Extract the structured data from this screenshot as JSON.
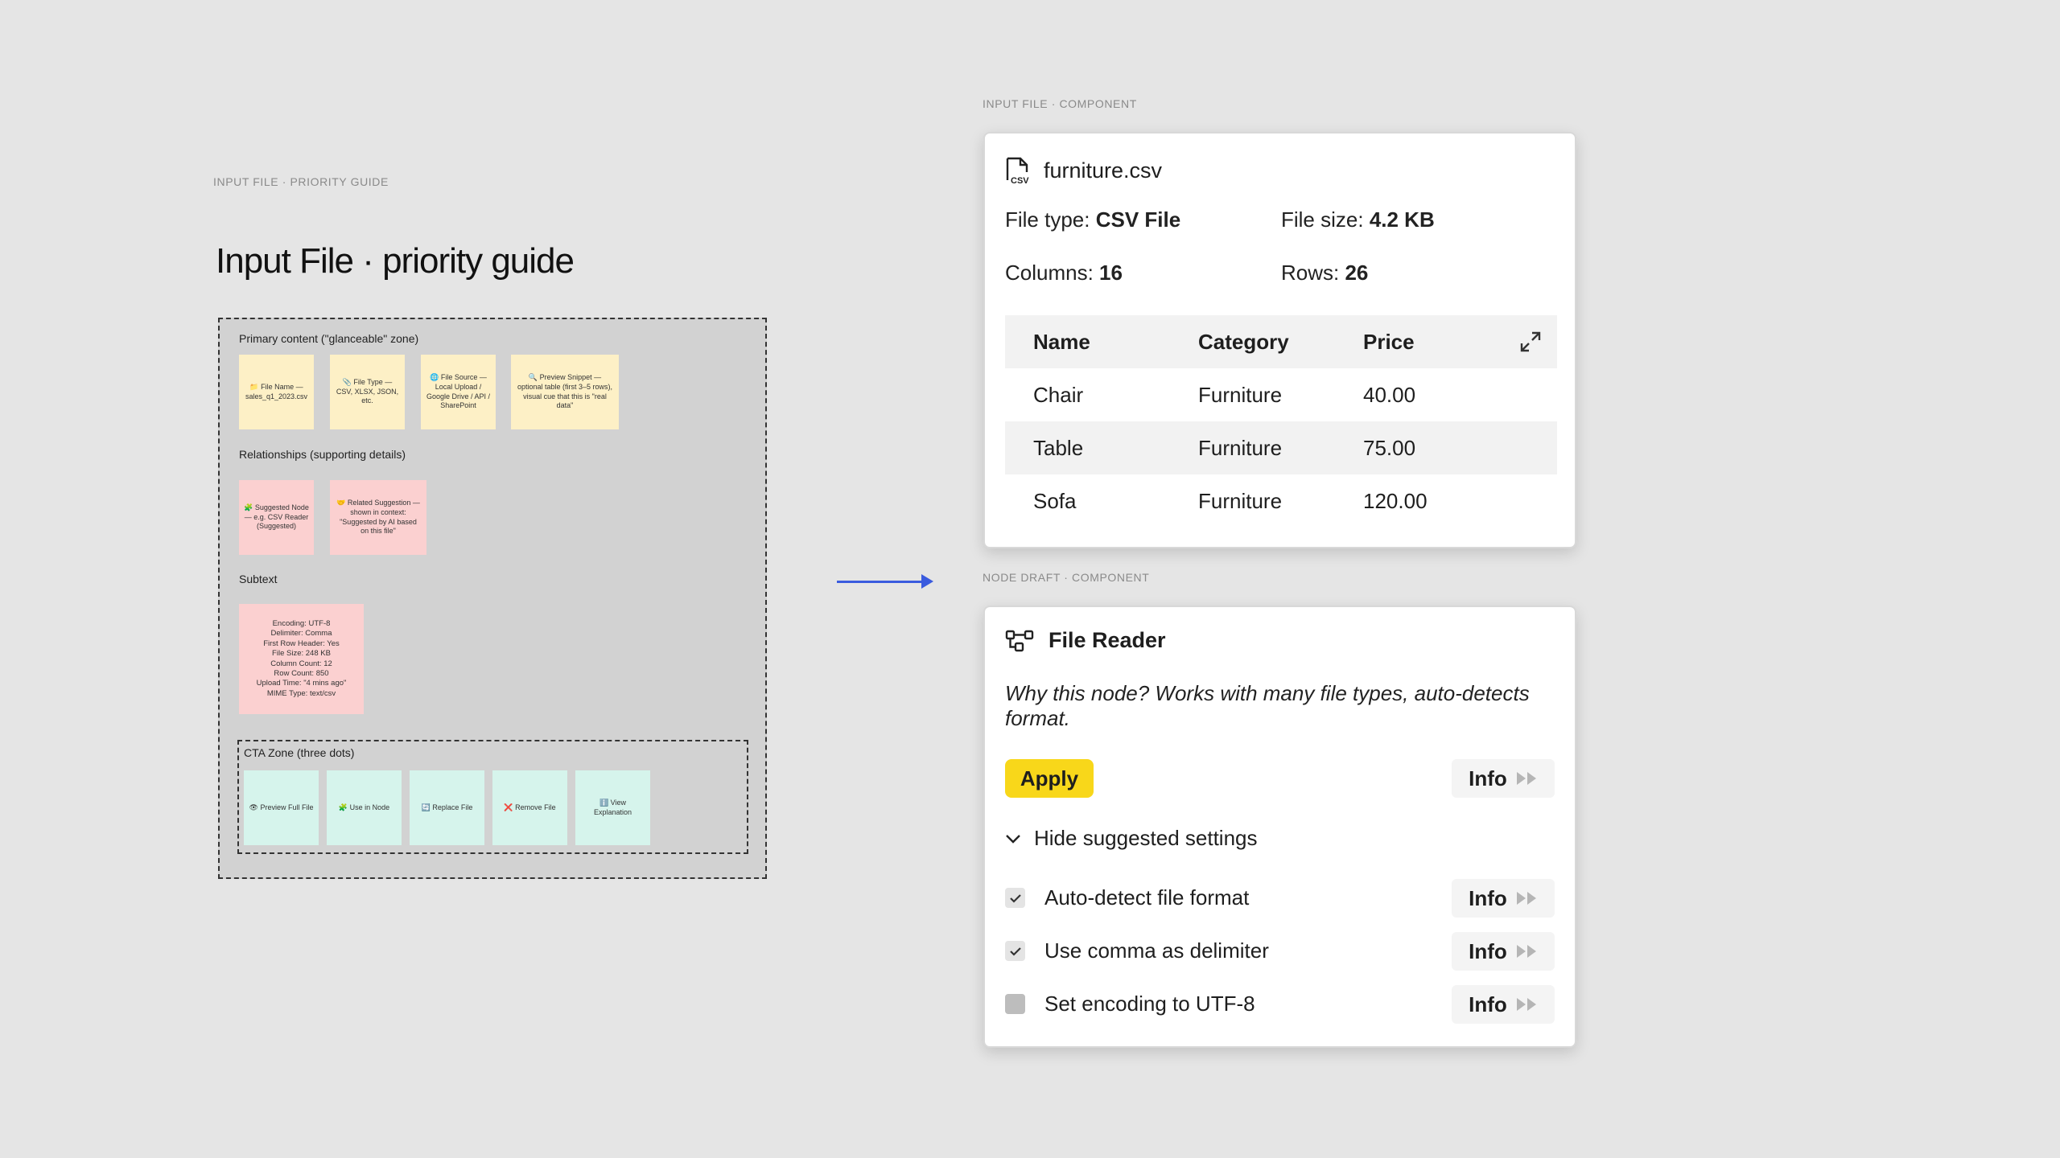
{
  "guide": {
    "frame_label": "INPUT FILE · PRIORITY GUIDE",
    "title": "Input File · priority guide",
    "primary_label": "Primary content (\"glanceable\" zone)",
    "primary_notes": [
      "📁 File Name — sales_q1_2023.csv",
      "📎 File Type — CSV, XLSX, JSON, etc.",
      "🌐 File Source — Local Upload / Google Drive / API / SharePoint",
      "🔍 Preview Snippet — optional table (first 3–5 rows), visual cue that this is \"real data\""
    ],
    "relationships_label": "Relationships (supporting details)",
    "relationship_notes": [
      "🧩 Suggested Node — e.g. CSV Reader (Suggested)",
      "🤝 Related Suggestion — shown in context: \"Suggested by AI based on this file\""
    ],
    "subtext_label": "Subtext",
    "subtext_note": "Encoding: UTF-8\nDelimiter: Comma\nFirst Row Header: Yes\nFile Size: 248 KB\nColumn Count: 12\nRow Count: 850\nUpload Time: \"4 mins ago\"\nMIME Type: text/csv",
    "cta_label": "CTA Zone (three dots)",
    "cta_notes": [
      "👁 Preview Full File",
      "🧩 Use in Node",
      "🔄 Replace File",
      "❌ Remove File",
      "ℹ️ View Explanation"
    ]
  },
  "file_card": {
    "frame_label": "INPUT FILE · COMPONENT",
    "file_icon": "csv-file-icon",
    "file_name": "furniture.csv",
    "file_type_label": "File type: ",
    "file_type": "CSV File",
    "file_size_label": "File size: ",
    "file_size": "4.2 KB",
    "columns_label": "Columns: ",
    "columns": "16",
    "rows_label": "Rows: ",
    "rows": "26",
    "table": {
      "headers": [
        "Name",
        "Category",
        "Price"
      ],
      "rows": [
        [
          "Chair",
          "Furniture",
          "40.00"
        ],
        [
          "Table",
          "Furniture",
          "75.00"
        ],
        [
          "Sofa",
          "Furniture",
          "120.00"
        ]
      ]
    }
  },
  "node_card": {
    "frame_label": "NODE DRAFT · COMPONENT",
    "title": "File Reader",
    "why": "Why this node? Works with many file types, auto-detects format.",
    "apply_label": "Apply",
    "info_label": "Info",
    "toggle_label": "Hide suggested settings",
    "settings": [
      {
        "label": "Auto-detect file format",
        "checked": true
      },
      {
        "label": "Use comma as delimiter",
        "checked": true
      },
      {
        "label": "Set encoding to UTF-8",
        "checked": false
      }
    ]
  },
  "colors": {
    "background": "#e5e5e5",
    "accent_yellow": "#f8d71a",
    "arrow_blue": "#3a5bde",
    "sticky_yellow": "#fdf0c6",
    "sticky_pink": "#fbd0d0",
    "sticky_mint": "#d6f4ec"
  }
}
